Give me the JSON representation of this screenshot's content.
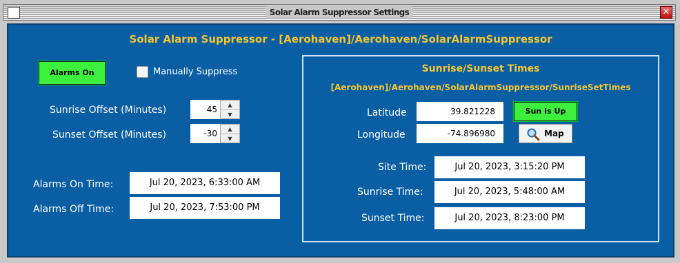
{
  "window": {
    "title": "Solar Alarm Suppressor Settings",
    "close_glyph": "✕"
  },
  "header": "Solar Alarm Suppressor - [Aerohaven]/Aerohaven/SolarAlarmSuppressor",
  "left": {
    "alarms_button": "Alarms On",
    "manually_suppress_label": "Manually Suppress",
    "manually_suppress_checked": false,
    "sunrise_offset_label": "Sunrise Offset (Minutes)",
    "sunrise_offset_value": "45",
    "sunset_offset_label": "Sunset Offset (Minutes)",
    "sunset_offset_value": "-30",
    "alarms_on_time_label": "Alarms On Time:",
    "alarms_on_time_value": "Jul 20, 2023, 6:33:00 AM",
    "alarms_off_time_label": "Alarms Off Time:",
    "alarms_off_time_value": "Jul 20, 2023, 7:53:00 PM"
  },
  "panel": {
    "title": "Sunrise/Sunset Times",
    "path": "[Aerohaven]/Aerohaven/SolarAlarmSuppressor/SunriseSetTimes",
    "latitude_label": "Latitude",
    "latitude_value": "39.821228",
    "longitude_label": "Longitude",
    "longitude_value": "-74.896980",
    "sun_status_button": "Sun Is Up",
    "map_button": "Map",
    "site_time_label": "Site Time:",
    "site_time_value": "Jul 20, 2023, 3:15:20 PM",
    "sunrise_time_label": "Sunrise Time:",
    "sunrise_time_value": "Jul 20, 2023, 5:48:00 AM",
    "sunset_time_label": "Sunset Time:",
    "sunset_time_value": "Jul 20, 2023, 8:23:00 PM"
  },
  "colors": {
    "background": "#0a5ea3",
    "accent_text": "#f4c531",
    "status_green": "#3df03d"
  },
  "icons": {
    "map": "magnifier-icon",
    "spinner_up": "▲",
    "spinner_down": "▼"
  }
}
